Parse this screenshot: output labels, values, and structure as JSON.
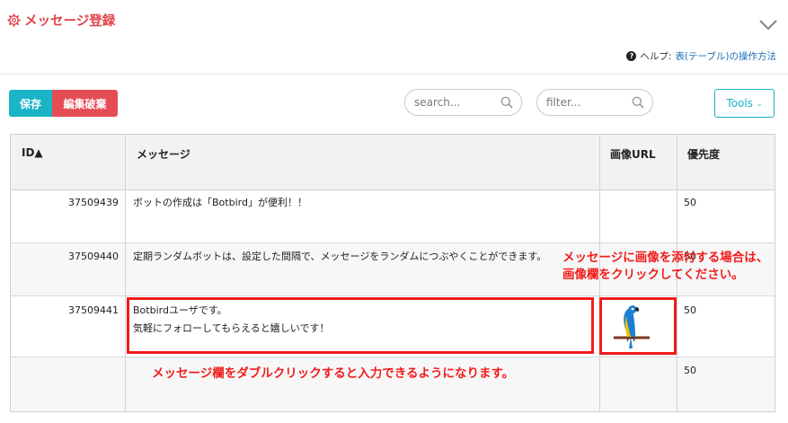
{
  "header": {
    "title": "メッセージ登録",
    "help_label": "ヘルプ:",
    "help_link": "表(テーブル)の操作方法"
  },
  "toolbar": {
    "save_label": "保存",
    "discard_label": "編集破棄",
    "search_placeholder": "search...",
    "filter_placeholder": "filter...",
    "tools_label": "Tools"
  },
  "table": {
    "columns": [
      "ID▲",
      "メッセージ",
      "画像URL",
      "優先度"
    ],
    "rows": [
      {
        "id": "37509439",
        "message_line1": "ボットの作成は「Botbird」が便利！！",
        "message_line2": "",
        "image": "",
        "priority": "50"
      },
      {
        "id": "37509440",
        "message_line1": "定期ランダムボットは、設定した間隔で、メッセージをランダムにつぶやくことができます。",
        "message_line2": "",
        "image": "",
        "priority": "50"
      },
      {
        "id": "37509441",
        "message_line1": "Botbirdユーザです。",
        "message_line2": "気軽にフォローしてもらえると嬉しいです！",
        "image": "parrot",
        "priority": "50"
      },
      {
        "id": "",
        "message_line1": "",
        "message_line2": "",
        "image": "",
        "priority": "50"
      }
    ]
  },
  "annotations": {
    "image_hint_line1": "メッセージに画像を添付する場合は、",
    "image_hint_line2": "画像欄をクリックしてください。",
    "message_hint": "メッセージ欄をダブルクリックすると入力できるようになります。"
  },
  "colors": {
    "brand_red": "#e0434a",
    "save_teal": "#1bb3c6",
    "discard_red": "#e54d55",
    "annotation_red": "#f21c1c"
  },
  "icons": [
    "gear-icon",
    "chevron-down-icon",
    "help-icon",
    "search-icon",
    "parrot-image"
  ]
}
